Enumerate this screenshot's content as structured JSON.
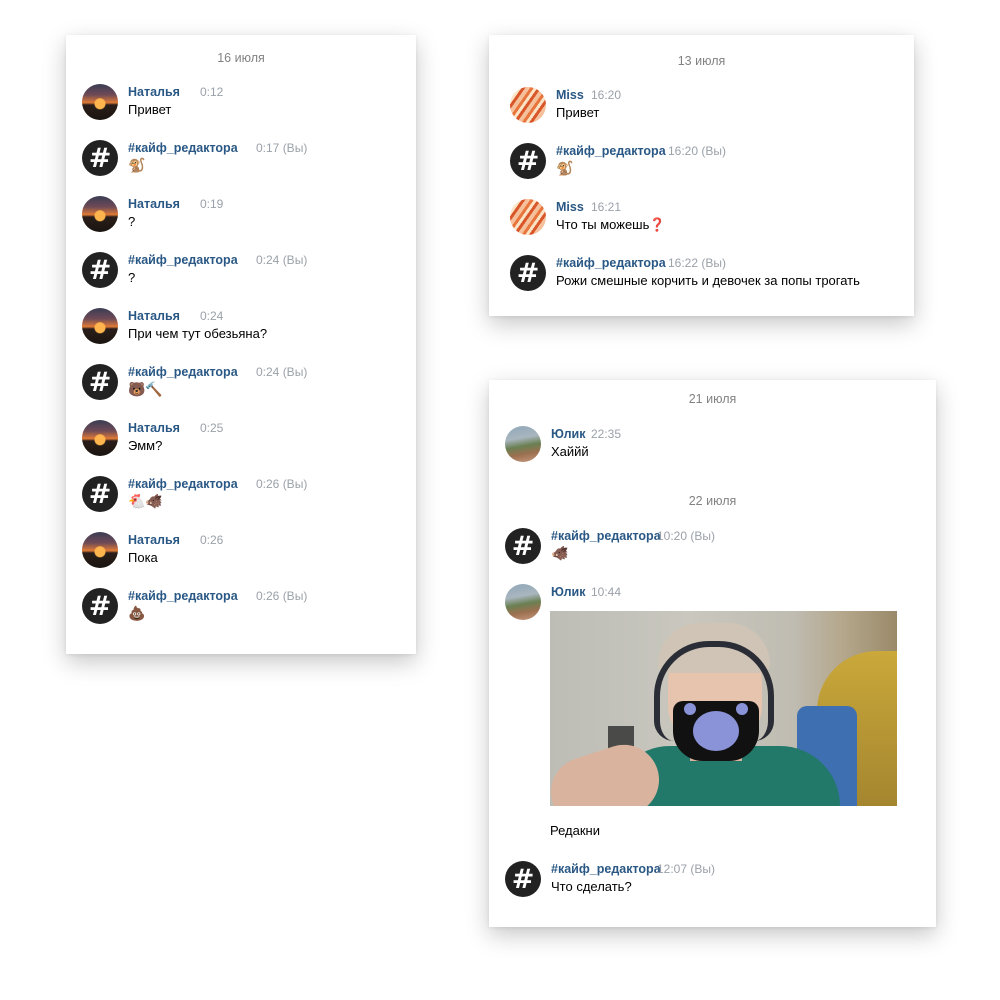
{
  "panels": [
    {
      "date": "16 июля",
      "messages": [
        {
          "author": "Наталья",
          "time": "0:12",
          "text": "Привет",
          "avatar": "sunset"
        },
        {
          "author": "#кайф_редактора",
          "time": "0:17 (Вы)",
          "text": "🐒",
          "avatar": "hash"
        },
        {
          "author": "Наталья",
          "time": "0:19",
          "text": "?",
          "avatar": "sunset"
        },
        {
          "author": "#кайф_редактора",
          "time": "0:24 (Вы)",
          "text": "?",
          "avatar": "hash"
        },
        {
          "author": "Наталья",
          "time": "0:24",
          "text": "При чем тут обезьяна?",
          "avatar": "sunset"
        },
        {
          "author": "#кайф_редактора",
          "time": "0:24 (Вы)",
          "text": "🐻🔨",
          "avatar": "hash"
        },
        {
          "author": "Наталья",
          "time": "0:25",
          "text": "Эмм?",
          "avatar": "sunset"
        },
        {
          "author": "#кайф_редактора",
          "time": "0:26 (Вы)",
          "text": "🐔🐗",
          "avatar": "hash"
        },
        {
          "author": "Наталья",
          "time": "0:26",
          "text": "Пока",
          "avatar": "sunset"
        },
        {
          "author": "#кайф_редактора",
          "time": "0:26 (Вы)",
          "text": "💩",
          "avatar": "hash"
        }
      ]
    },
    {
      "date": "13 июля",
      "messages": [
        {
          "author": "Miss",
          "time": "16:20",
          "text": "Привет",
          "avatar": "miss"
        },
        {
          "author": "#кайф_редактора",
          "time": "16:20 (Вы)",
          "text": "🐒",
          "avatar": "hash"
        },
        {
          "author": "Miss",
          "time": "16:21",
          "text": "Что ты можешь❓",
          "avatar": "miss"
        },
        {
          "author": "#кайф_редактора",
          "time": "16:22 (Вы)",
          "text": "Рожи смешные корчить и девочек за попы трогать",
          "avatar": "hash"
        }
      ]
    },
    {
      "date1": "21 июля",
      "msg1": {
        "author": "Юлик",
        "time": "22:35",
        "text": "Хаййй",
        "avatar": "yulik"
      },
      "date2": "22 июля",
      "msg2": {
        "author": "#кайф_редактора",
        "time": "10:20 (Вы)",
        "text": "🐗",
        "avatar": "hash"
      },
      "msg3": {
        "author": "Юлик",
        "time": "10:44",
        "caption": "Редакни",
        "avatar": "yulik"
      },
      "msg4": {
        "author": "#кайф_редактора",
        "time": "12:07 (Вы)",
        "text": "Что сделать?",
        "avatar": "hash"
      }
    }
  ],
  "hash_symbol": "#"
}
